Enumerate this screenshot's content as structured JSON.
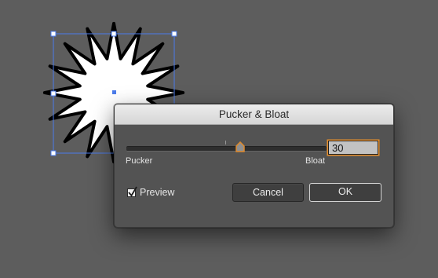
{
  "dialog": {
    "title": "Pucker & Bloat",
    "slider": {
      "left_label": "Pucker",
      "right_label": "Bloat",
      "value": 30,
      "min": -100,
      "max": 100
    },
    "value_input": "30",
    "preview": {
      "label": "Preview",
      "checked": true
    },
    "buttons": {
      "cancel": "Cancel",
      "ok": "OK"
    }
  },
  "colors": {
    "canvas_background": "#5d5d5d",
    "dialog_background": "#535353",
    "selection_blue": "#4b7bea",
    "focus_orange": "#e7902e"
  },
  "icons": {
    "slider_thumb": "slider-thumb-icon",
    "check": "checkmark-icon"
  }
}
